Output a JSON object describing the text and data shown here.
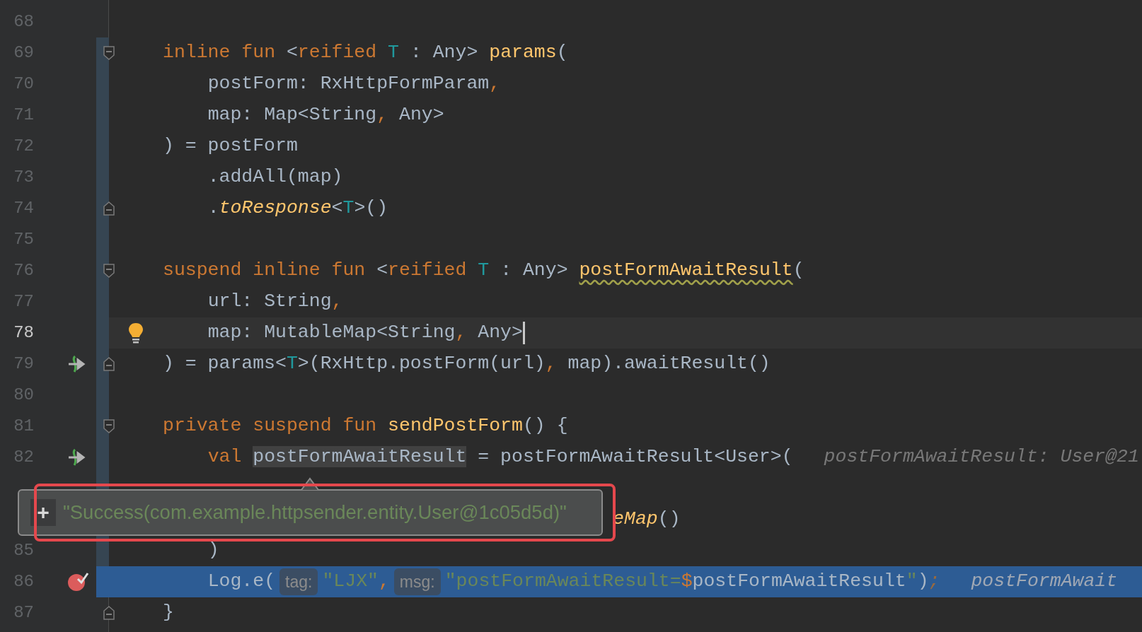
{
  "editor": {
    "lines": [
      {
        "number": "68",
        "current": false,
        "execution_point": false,
        "changed": false,
        "fold_start": false,
        "fold_end": false
      },
      {
        "number": "69",
        "current": false,
        "execution_point": false,
        "changed": true,
        "fold_start": true,
        "fold_end": false,
        "segments": [
          {
            "kind": "code",
            "tokens": [
              {
                "kind": "keyword",
                "text": "inline"
              },
              {
                "kind": "keyword",
                "text": " fun"
              },
              {
                "kind": "plain",
                "text": " <"
              },
              {
                "kind": "keyword",
                "text": "reified"
              },
              {
                "kind": "type_param",
                "text": " T"
              },
              {
                "kind": "plain",
                "text": " : Any> "
              },
              {
                "kind": "declaration",
                "text": "params"
              },
              {
                "kind": "plain",
                "text": "("
              }
            ]
          }
        ]
      },
      {
        "number": "70",
        "current": false,
        "execution_point": false,
        "changed": true,
        "fold_start": false,
        "fold_end": false,
        "segments": [
          {
            "kind": "code",
            "tokens": [
              {
                "kind": "plain",
                "text": "    postForm: RxHttpFormParam"
              },
              {
                "kind": "punctuation",
                "text": ","
              }
            ]
          }
        ]
      },
      {
        "number": "71",
        "current": false,
        "execution_point": false,
        "changed": true,
        "fold_start": false,
        "fold_end": false,
        "segments": [
          {
            "kind": "code",
            "tokens": [
              {
                "kind": "plain",
                "text": "    map: Map<String"
              },
              {
                "kind": "punctuation",
                "text": ","
              },
              {
                "kind": "plain",
                "text": " Any>"
              }
            ]
          }
        ]
      },
      {
        "number": "72",
        "current": false,
        "execution_point": false,
        "changed": true,
        "fold_start": false,
        "fold_end": false,
        "segments": [
          {
            "kind": "code",
            "tokens": [
              {
                "kind": "plain",
                "text": ") = postForm"
              }
            ]
          }
        ]
      },
      {
        "number": "73",
        "current": false,
        "execution_point": false,
        "changed": true,
        "fold_start": false,
        "fold_end": false,
        "segments": [
          {
            "kind": "code",
            "tokens": [
              {
                "kind": "plain",
                "text": "    .addAll(map)"
              }
            ]
          }
        ]
      },
      {
        "number": "74",
        "current": false,
        "execution_point": false,
        "changed": true,
        "fold_start": false,
        "fold_end": true,
        "segments": [
          {
            "kind": "code",
            "tokens": [
              {
                "kind": "plain",
                "text": "    ."
              },
              {
                "kind": "extension",
                "text": "toResponse"
              },
              {
                "kind": "plain",
                "text": "<"
              },
              {
                "kind": "type_param",
                "text": "T"
              },
              {
                "kind": "plain",
                "text": ">()"
              }
            ]
          }
        ]
      },
      {
        "number": "75",
        "current": false,
        "execution_point": false,
        "changed": true,
        "fold_start": false,
        "fold_end": false
      },
      {
        "number": "76",
        "current": false,
        "execution_point": false,
        "changed": true,
        "fold_start": true,
        "fold_end": false,
        "segments": [
          {
            "kind": "code",
            "tokens": [
              {
                "kind": "keyword",
                "text": "suspend"
              },
              {
                "kind": "keyword",
                "text": " inline"
              },
              {
                "kind": "keyword",
                "text": " fun"
              },
              {
                "kind": "plain",
                "text": " <"
              },
              {
                "kind": "keyword",
                "text": "reified"
              },
              {
                "kind": "type_param",
                "text": " T"
              },
              {
                "kind": "plain",
                "text": " : Any> "
              },
              {
                "kind": "warning",
                "text": "postFormAwaitResult"
              },
              {
                "kind": "plain",
                "text": "("
              }
            ]
          }
        ]
      },
      {
        "number": "77",
        "current": false,
        "execution_point": false,
        "changed": true,
        "fold_start": false,
        "fold_end": false,
        "segments": [
          {
            "kind": "code",
            "tokens": [
              {
                "kind": "plain",
                "text": "    url: String"
              },
              {
                "kind": "punctuation",
                "text": ","
              }
            ]
          }
        ]
      },
      {
        "number": "78",
        "current": true,
        "execution_point": false,
        "changed": true,
        "fold_start": false,
        "fold_end": false,
        "margin_icon": {
          "kind": "bulb"
        },
        "segments": [
          {
            "kind": "code",
            "tokens": [
              {
                "kind": "plain",
                "text": "    map: MutableMap<String"
              },
              {
                "kind": "punctuation",
                "text": ","
              },
              {
                "kind": "plain",
                "text": " Any>"
              }
            ]
          }
        ]
      },
      {
        "number": "79",
        "current": false,
        "execution_point": false,
        "changed": true,
        "fold_start": false,
        "fold_end": true,
        "gutter_icon": {
          "kind": "suspend_call"
        },
        "segments": [
          {
            "kind": "code",
            "tokens": [
              {
                "kind": "plain",
                "text": ") = params<"
              },
              {
                "kind": "type_param",
                "text": "T"
              },
              {
                "kind": "plain",
                "text": ">(RxHttp.postForm(url)"
              },
              {
                "kind": "punctuation",
                "text": ","
              },
              {
                "kind": "plain",
                "text": " map).awaitResult()"
              }
            ]
          }
        ]
      },
      {
        "number": "80",
        "current": false,
        "execution_point": false,
        "changed": true,
        "fold_start": false,
        "fold_end": false
      },
      {
        "number": "81",
        "current": false,
        "execution_point": false,
        "changed": true,
        "fold_start": true,
        "fold_end": false,
        "segments": [
          {
            "kind": "code",
            "tokens": [
              {
                "kind": "keyword",
                "text": "private"
              },
              {
                "kind": "keyword",
                "text": " suspend"
              },
              {
                "kind": "keyword",
                "text": " fun"
              },
              {
                "kind": "declaration",
                "text": " sendPostForm"
              },
              {
                "kind": "plain",
                "text": "() {"
              }
            ]
          }
        ]
      },
      {
        "number": "82",
        "current": false,
        "execution_point": false,
        "changed": true,
        "fold_start": false,
        "fold_end": false,
        "gutter_icon": {
          "kind": "suspend_call"
        },
        "segments": [
          {
            "kind": "code",
            "tokens": [
              {
                "kind": "keyword",
                "text": "    val "
              },
              {
                "kind": "usage",
                "text": "postFormAwaitResult"
              },
              {
                "kind": "plain",
                "text": " = postFormAwaitResult<User>("
              }
            ]
          },
          {
            "kind": "value_hint",
            "text": "postFormAwaitResult: User@21"
          }
        ]
      },
      {
        "current": false,
        "execution_point": false,
        "changed": true,
        "fold_start": false,
        "fold_end": false
      },
      {
        "current": false,
        "execution_point": false,
        "changed": false,
        "fold_start": false,
        "fold_end": false,
        "segments": [
          {
            "kind": "code",
            "tokens": [
              {
                "kind": "extension",
                "text": "                                        eMap"
              },
              {
                "kind": "plain",
                "text": "()"
              }
            ]
          }
        ]
      },
      {
        "number": "85",
        "current": false,
        "execution_point": false,
        "changed": true,
        "fold_start": false,
        "fold_end": false,
        "segments": [
          {
            "kind": "code",
            "tokens": [
              {
                "kind": "plain",
                "text": "    )"
              }
            ]
          }
        ]
      },
      {
        "number": "86",
        "current": false,
        "execution_point": true,
        "changed": false,
        "fold_start": false,
        "fold_end": false,
        "gutter_icon": {
          "kind": "breakpoint"
        },
        "segments": [
          {
            "kind": "code",
            "tokens": [
              {
                "kind": "plain",
                "text": "    Log.e("
              }
            ]
          },
          {
            "kind": "param_hint",
            "text": "tag:"
          },
          {
            "kind": "code",
            "tokens": [
              {
                "kind": "string",
                "text": "\"LJX\""
              },
              {
                "kind": "punctuation",
                "text": ","
              }
            ]
          },
          {
            "kind": "param_hint",
            "text": "msg:"
          },
          {
            "kind": "code",
            "tokens": [
              {
                "kind": "string",
                "text": "\"postFormAwaitResult="
              },
              {
                "kind": "punctuation",
                "text": "$"
              },
              {
                "kind": "plain",
                "text": "postFormAwaitResult"
              },
              {
                "kind": "string",
                "text": "\""
              },
              {
                "kind": "plain",
                "text": ")"
              },
              {
                "kind": "semicolon",
                "text": ";"
              }
            ]
          },
          {
            "kind": "value_hint",
            "text": "postFormAwait"
          }
        ]
      },
      {
        "number": "87",
        "current": false,
        "execution_point": false,
        "changed": false,
        "fold_start": false,
        "fold_end": true,
        "segments": [
          {
            "kind": "code",
            "tokens": [
              {
                "kind": "plain",
                "text": "}"
              }
            ]
          }
        ]
      }
    ]
  },
  "value_popup": {
    "expand_button": "+",
    "value": "\"Success(com.example.httpsender.entity.User@1c05d5d)\"",
    "highlight_frame": true
  }
}
